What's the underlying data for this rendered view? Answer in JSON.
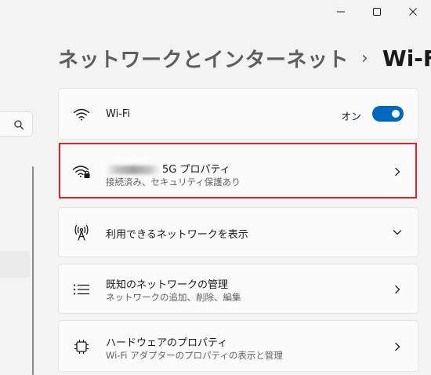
{
  "header": {
    "breadcrumb_parent": "ネットワークとインターネット",
    "separator": "›",
    "current": "Wi-Fi"
  },
  "wifi_toggle": {
    "label": "Wi-Fi",
    "state_label": "オン",
    "on": true
  },
  "network_properties": {
    "title_suffix": "5G プロパティ",
    "status": "接続済み、セキュリティ保護あり"
  },
  "show_networks": {
    "label": "利用できるネットワークを表示"
  },
  "manage_networks": {
    "title": "既知のネットワークの管理",
    "subtitle": "ネットワークの追加、削除、編集"
  },
  "hardware_properties": {
    "title": "ハードウェアのプロパティ",
    "subtitle": "Wi-Fi アダプターのプロパティの表示と管理"
  },
  "colors": {
    "accent": "#0067c0",
    "highlight_border": "#d9262e",
    "background": "#f3f3f3",
    "card": "#fbfbfb"
  },
  "icons": {
    "search": "search-icon",
    "minimize": "minimize-icon",
    "maximize": "maximize-icon",
    "close": "close-icon",
    "wifi": "wifi-icon",
    "wifi_secure": "wifi-lock-icon",
    "antenna": "antenna-icon",
    "list": "list-icon",
    "chip": "chip-icon",
    "chevron_right": "chevron-right-icon",
    "chevron_down": "chevron-down-icon"
  }
}
